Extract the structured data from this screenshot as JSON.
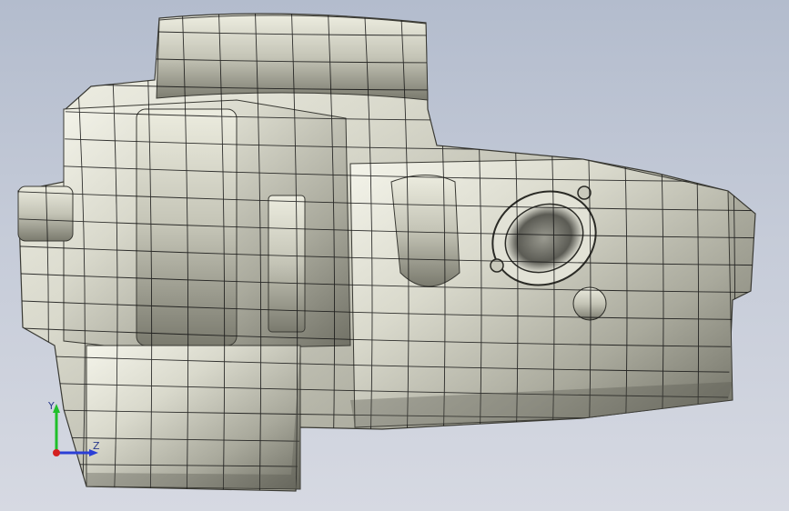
{
  "viewport": {
    "background_top": "#b3bccd",
    "background_bottom": "#d6d9e2"
  },
  "model": {
    "surface_color": "#d8d8cc",
    "shadow_color": "#8a8a80",
    "mesh_color": "#111111"
  },
  "triad": {
    "x_label": "",
    "y_label": "Y",
    "z_label": "Z",
    "y_color": "#1fbf2a",
    "z_color": "#2b3fd6",
    "x_color": "#d42020"
  }
}
